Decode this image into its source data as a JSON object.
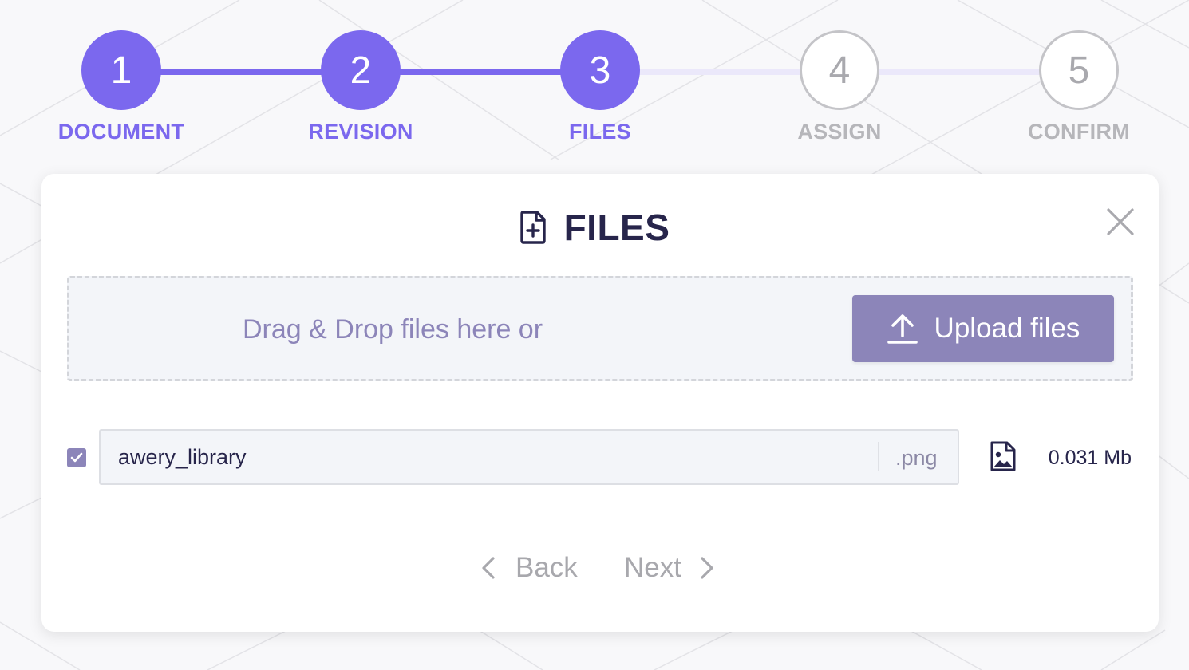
{
  "stepper": {
    "steps": [
      {
        "number": "1",
        "label": "DOCUMENT",
        "state": "active"
      },
      {
        "number": "2",
        "label": "REVISION",
        "state": "active"
      },
      {
        "number": "3",
        "label": "FILES",
        "state": "active"
      },
      {
        "number": "4",
        "label": "ASSIGN",
        "state": "inactive"
      },
      {
        "number": "5",
        "label": "CONFIRM",
        "state": "inactive"
      }
    ],
    "current_step": 3
  },
  "card": {
    "title": "FILES",
    "header_icon": "file-plus-icon",
    "close_icon": "close-icon"
  },
  "dropzone": {
    "text": "Drag & Drop files here or",
    "upload_label": "Upload files",
    "upload_icon": "upload-arrow-icon"
  },
  "files": [
    {
      "checked": true,
      "name": "awery_library",
      "extension": ".png",
      "type_icon": "image-file-icon",
      "size": "0.031 Mb"
    }
  ],
  "navigation": {
    "back_label": "Back",
    "next_label": "Next"
  },
  "colors": {
    "accent": "#7b68ee",
    "muted_accent": "#8c85b9",
    "inactive": "#b6b6ba",
    "title": "#27254b"
  }
}
